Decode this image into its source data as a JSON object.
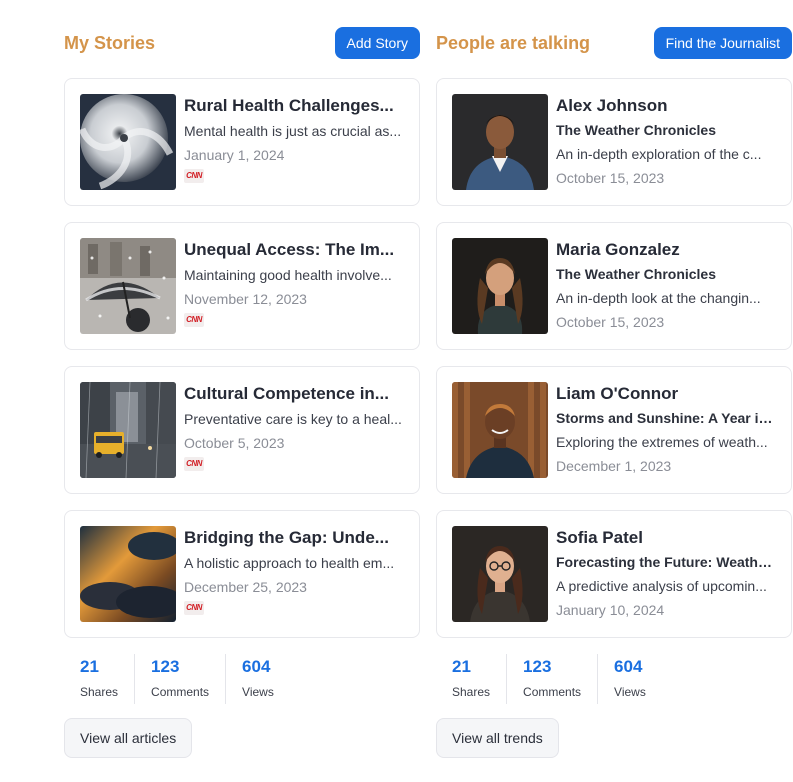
{
  "my_stories": {
    "title": "My Stories",
    "add_button": "Add Story",
    "items": [
      {
        "title": "Rural Health Challenges...",
        "desc": "Mental health is just as crucial as...",
        "date": "January 1, 2024",
        "source": "CNN"
      },
      {
        "title": "Unequal Access: The Im...",
        "desc": "Maintaining good health involve...",
        "date": "November 12, 2023",
        "source": "CNN"
      },
      {
        "title": "Cultural Competence in...",
        "desc": "Preventative care is key to a heal...",
        "date": "October 5, 2023",
        "source": "CNN"
      },
      {
        "title": "Bridging the Gap: Unde...",
        "desc": "A holistic approach to health em...",
        "date": "December 25, 2023",
        "source": "CNN"
      }
    ],
    "stats": [
      {
        "value": "21",
        "label": "Shares"
      },
      {
        "value": "123",
        "label": "Comments"
      },
      {
        "value": "604",
        "label": "Views"
      }
    ],
    "view_all": "View all articles"
  },
  "people_talking": {
    "title": "People are talking",
    "find_button": "Find the Journalist",
    "items": [
      {
        "name": "Alex Johnson",
        "publication": "The Weather Chronicles",
        "desc": "An in-depth exploration of the c...",
        "date": "October 15, 2023"
      },
      {
        "name": "Maria Gonzalez",
        "publication": "The Weather Chronicles",
        "desc": "An in-depth look at the changin...",
        "date": "October 15, 2023"
      },
      {
        "name": "Liam O'Connor",
        "publication": "Storms and Sunshine: A Year in...",
        "desc": "Exploring the extremes of weath...",
        "date": "December 1, 2023"
      },
      {
        "name": "Sofia Patel",
        "publication": "Forecasting the Future: Weather...",
        "desc": "A predictive analysis of upcomin...",
        "date": "January 10, 2024"
      }
    ],
    "stats": [
      {
        "value": "21",
        "label": "Shares"
      },
      {
        "value": "123",
        "label": "Comments"
      },
      {
        "value": "604",
        "label": "Views"
      }
    ],
    "view_all": "View all trends"
  }
}
